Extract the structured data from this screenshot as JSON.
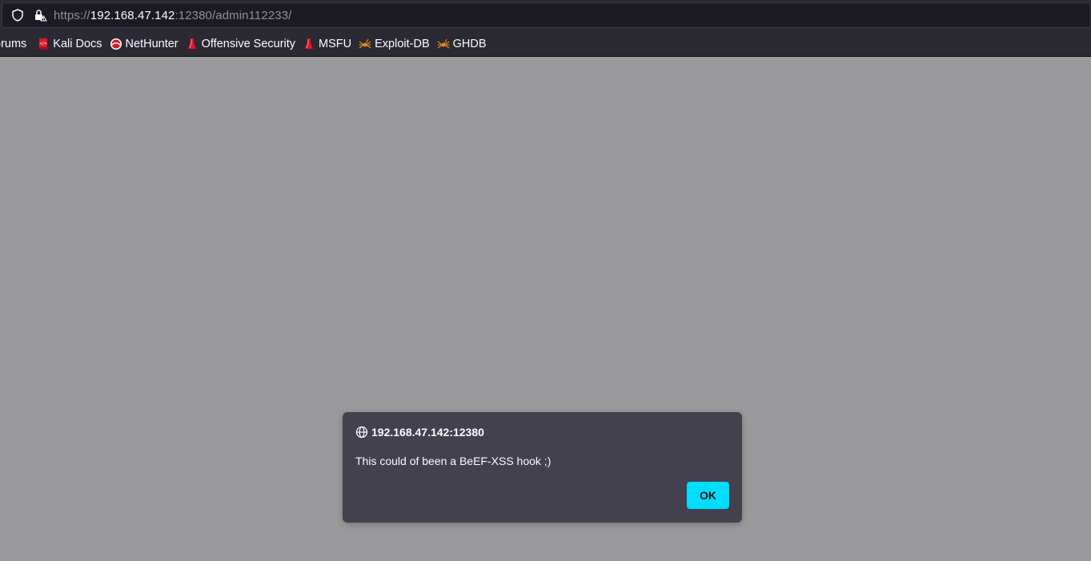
{
  "urlbar": {
    "url_prefix": "https://",
    "url_host": "192.168.47.142",
    "url_suffix": ":12380/admin112233/"
  },
  "bookmarks": [
    {
      "label": "orums",
      "icon": "forum-icon"
    },
    {
      "label": "Kali Docs",
      "icon": "kali-docs-icon"
    },
    {
      "label": "NetHunter",
      "icon": "nethunter-icon"
    },
    {
      "label": "Offensive Security",
      "icon": "offsec-icon"
    },
    {
      "label": "MSFU",
      "icon": "offsec-icon"
    },
    {
      "label": "Exploit-DB",
      "icon": "exploitdb-icon"
    },
    {
      "label": "GHDB",
      "icon": "exploitdb-icon"
    }
  ],
  "dialog": {
    "title": "192.168.47.142:12380",
    "message": "This could of been a BeEF-XSS hook ;)",
    "ok_label": "OK"
  },
  "colors": {
    "page_background": "#9a9a9c",
    "chrome_background": "#2b2a33",
    "dialog_background": "#42414d",
    "accent": "#00ddff"
  }
}
